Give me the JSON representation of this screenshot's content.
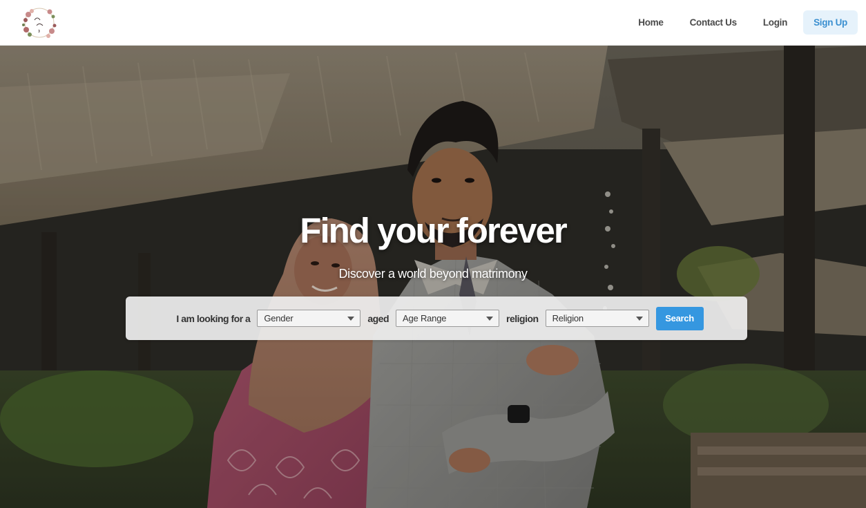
{
  "header": {
    "logo_text": "Biya Rishta",
    "nav": {
      "home": "Home",
      "contact": "Contact Us",
      "login": "Login",
      "signup": "Sign Up"
    }
  },
  "hero": {
    "title": "Find your forever",
    "subtitle": "Discover a world beyond matrimony"
  },
  "search": {
    "label_looking": "I am looking for a",
    "gender_value": "Gender",
    "label_aged": "aged",
    "age_value": "Age Range",
    "label_religion": "religion",
    "religion_value": "Religion",
    "button": "Search"
  },
  "colors": {
    "accent": "#3597e0",
    "signup_bg": "#e6f2fb",
    "signup_text": "#3a8fd0",
    "nav_text": "#4a4a4a"
  }
}
